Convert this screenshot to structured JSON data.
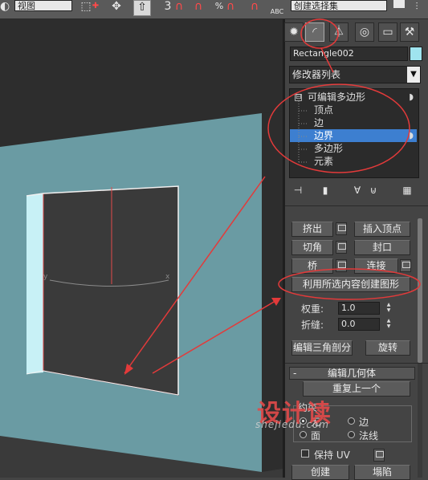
{
  "toolbar": {
    "view_combo": "视图",
    "selection_set_combo": "创建选择集",
    "abc_label": "ABC"
  },
  "panel": {
    "object_name": "Rectangle002",
    "modifier_list": "修改器列表",
    "stack": [
      {
        "label": "可编辑多边形",
        "level": 0,
        "selected": false
      },
      {
        "label": "顶点",
        "level": 1,
        "selected": false
      },
      {
        "label": "边",
        "level": 1,
        "selected": false
      },
      {
        "label": "边界",
        "level": 1,
        "selected": true
      },
      {
        "label": "多边形",
        "level": 1,
        "selected": false
      },
      {
        "label": "元素",
        "level": 1,
        "selected": false
      }
    ],
    "stack_expander": "⊟",
    "buttons": {
      "extrude": "挤出",
      "insert_vertex": "插入顶点",
      "chamfer": "切角",
      "cap": "封口",
      "bridge": "桥",
      "connect": "连接",
      "create_shape": "利用所选内容创建图形",
      "edit_tri": "编辑三角剖分",
      "turn": "旋转"
    },
    "weight_label": "权重:",
    "weight_value": "1.0",
    "crease_label": "折缝:",
    "crease_value": "0.0",
    "edit_geometry_header": "编辑几何体",
    "edit_geometry_toggle": "-",
    "repeat_last": "重复上一个",
    "constraints_label": "约束",
    "constraint_options": [
      "无",
      "边",
      "面",
      "法线"
    ],
    "preserve_uv": "保持 UV",
    "create": "创建",
    "collapse": "塌陷"
  },
  "viewport": {
    "axis_x": "x",
    "axis_y": "y"
  },
  "watermark": {
    "brand": "设计读",
    "site": "shejiedu.com"
  }
}
